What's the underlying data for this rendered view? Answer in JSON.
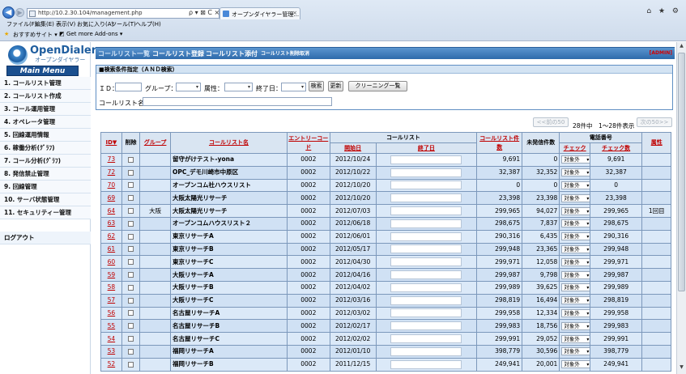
{
  "browser": {
    "url": "http://10.2.30.104/management.php",
    "addr_tools": "ρ ▾ ⊠ C ×",
    "tab_title": "オープンダイヤラー管理...",
    "tab_close": "×",
    "menu": [
      "ファイル(F)",
      "編集(E)",
      "表示(V)",
      "お気に入り(A)",
      "ツール(T)",
      "ヘルプ(H)"
    ],
    "favorites": [
      "おすすめサイト ▾",
      "Get more Add-ons ▾"
    ],
    "right_icons": "⌂ ★ ⚙"
  },
  "sidebar": {
    "logo_title": "OpenDialer",
    "logo_sub": "オープンダイヤラー",
    "menu_title": "Main Menu",
    "items": [
      "1. コールリスト管理",
      "2. コールリスト作成",
      "3. コール運用管理",
      "4. オペレータ管理",
      "5. 回線運用情報",
      "6. 稼働分析(ｸﾞﾗﾌ)",
      "7. コール分析(ｸﾞﾗﾌ)",
      "8. 発信禁止管理",
      "9. 回線管理",
      "10. サーバ状態管理",
      "11. セキュリティー管理"
    ],
    "logout": "ログアウト"
  },
  "tabs": [
    "コールリスト一覧",
    "コールリスト登録",
    "コールリスト添付",
    "コールリスト削除取消"
  ],
  "admin_label": "[ADMIN]",
  "search": {
    "heading": "■検索条件指定（ＡＮＤ検索）",
    "id_label": "ＩＤ：",
    "group_label": "グループ：",
    "attr_label": "属性：",
    "enddate_label": "終了日：",
    "search_button": "検索",
    "refresh_button": "更新",
    "cleaning_button": "クリーニング一覧",
    "calllist_label": "コールリスト名:"
  },
  "pager": {
    "prev": "<<前の50",
    "info": "28件中　1～28件表示",
    "next": "次の50>>"
  },
  "table": {
    "headers": {
      "id": "ID▼",
      "del": "削除",
      "group": "グループ",
      "name": "コールリスト名",
      "entry": "エントリーコード",
      "calllist": "コールリスト",
      "start": "開始日",
      "end": "終了日",
      "count": "コールリスト件数",
      "unsent": "未発信件数",
      "phone": "電話番号",
      "check": "チェック",
      "check_count": "チェック数",
      "attr": "属性"
    },
    "rows": [
      {
        "id": "73",
        "group": "",
        "name": "留守がけテスト-yona",
        "entry": "0002",
        "start": "2012/10/24",
        "count": "9,691",
        "unsent": "0",
        "check": "対象外",
        "check_count": "9,691",
        "attr": ""
      },
      {
        "id": "72",
        "group": "",
        "name": "OPC_デモ川崎市中原区",
        "entry": "0002",
        "start": "2012/10/22",
        "count": "32,387",
        "unsent": "32,352",
        "check": "対象外",
        "check_count": "32,387",
        "attr": ""
      },
      {
        "id": "70",
        "group": "",
        "name": "オープンコム社ハウスリスト",
        "entry": "0002",
        "start": "2012/10/20",
        "count": "0",
        "unsent": "0",
        "check": "対象外",
        "check_count": "0",
        "attr": ""
      },
      {
        "id": "69",
        "group": "",
        "name": "大阪太陽光リサーチ",
        "entry": "0002",
        "start": "2012/10/20",
        "count": "23,398",
        "unsent": "23,398",
        "check": "対象外",
        "check_count": "23,398",
        "attr": ""
      },
      {
        "id": "64",
        "group": "大阪",
        "name": "大阪太陽光リサーチ",
        "entry": "0002",
        "start": "2012/07/03",
        "count": "299,965",
        "unsent": "94,027",
        "check": "対象外",
        "check_count": "299,965",
        "attr": "1回目"
      },
      {
        "id": "63",
        "group": "",
        "name": "オープンコムハウスリスト２",
        "entry": "0002",
        "start": "2012/06/18",
        "count": "298,675",
        "unsent": "7,837",
        "check": "対象外",
        "check_count": "298,675",
        "attr": ""
      },
      {
        "id": "62",
        "group": "",
        "name": "東京リサーチA",
        "entry": "0002",
        "start": "2012/06/01",
        "count": "290,316",
        "unsent": "6,435",
        "check": "対象外",
        "check_count": "290,316",
        "attr": ""
      },
      {
        "id": "61",
        "group": "",
        "name": "東京リサーチB",
        "entry": "0002",
        "start": "2012/05/17",
        "count": "299,948",
        "unsent": "23,365",
        "check": "対象外",
        "check_count": "299,948",
        "attr": ""
      },
      {
        "id": "60",
        "group": "",
        "name": "東京リサーチC",
        "entry": "0002",
        "start": "2012/04/30",
        "count": "299,971",
        "unsent": "12,058",
        "check": "対象外",
        "check_count": "299,971",
        "attr": ""
      },
      {
        "id": "59",
        "group": "",
        "name": "大阪リサーチA",
        "entry": "0002",
        "start": "2012/04/16",
        "count": "299,987",
        "unsent": "9,798",
        "check": "対象外",
        "check_count": "299,987",
        "attr": ""
      },
      {
        "id": "58",
        "group": "",
        "name": "大阪リサーチB",
        "entry": "0002",
        "start": "2012/04/02",
        "count": "299,989",
        "unsent": "39,625",
        "check": "対象外",
        "check_count": "299,989",
        "attr": ""
      },
      {
        "id": "57",
        "group": "",
        "name": "大阪リサーチC",
        "entry": "0002",
        "start": "2012/03/16",
        "count": "298,819",
        "unsent": "16,494",
        "check": "対象外",
        "check_count": "298,819",
        "attr": ""
      },
      {
        "id": "56",
        "group": "",
        "name": "名古屋リサーチA",
        "entry": "0002",
        "start": "2012/03/02",
        "count": "299,958",
        "unsent": "12,334",
        "check": "対象外",
        "check_count": "299,958",
        "attr": ""
      },
      {
        "id": "55",
        "group": "",
        "name": "名古屋リサーチB",
        "entry": "0002",
        "start": "2012/02/17",
        "count": "299,983",
        "unsent": "18,756",
        "check": "対象外",
        "check_count": "299,983",
        "attr": ""
      },
      {
        "id": "54",
        "group": "",
        "name": "名古屋リサーチC",
        "entry": "0002",
        "start": "2012/02/02",
        "count": "299,991",
        "unsent": "29,052",
        "check": "対象外",
        "check_count": "299,991",
        "attr": ""
      },
      {
        "id": "53",
        "group": "",
        "name": "福岡リサーチA",
        "entry": "0002",
        "start": "2012/01/10",
        "count": "398,779",
        "unsent": "30,596",
        "check": "対象外",
        "check_count": "398,779",
        "attr": ""
      },
      {
        "id": "52",
        "group": "",
        "name": "福岡リサーチB",
        "entry": "0002",
        "start": "2011/12/15",
        "count": "249,941",
        "unsent": "20,001",
        "check": "対象外",
        "check_count": "249,941",
        "attr": ""
      }
    ]
  }
}
